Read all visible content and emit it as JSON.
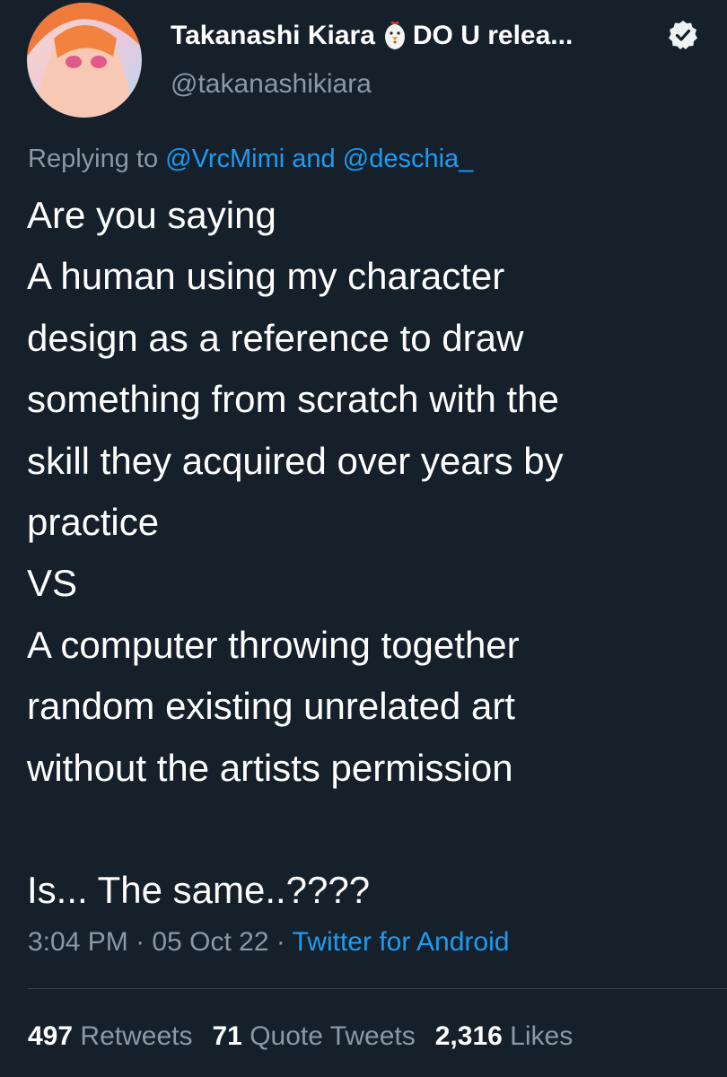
{
  "author": {
    "display_name": "Takanashi Kiara",
    "name_emoji": "chicken-emoji",
    "name_suffix": "DO U relea...",
    "handle": "@takanashikiara",
    "verified_icon": "verified-badge-icon"
  },
  "reply": {
    "prefix": "Replying to",
    "user1": "@VrcMimi",
    "conjunction": "and",
    "user2": "@deschia_"
  },
  "tweet": {
    "lines": [
      "Are you saying",
      "A human using my character",
      "design as a reference to draw",
      "something from scratch with the",
      "skill they acquired over years by",
      "practice",
      "VS",
      "A computer throwing together",
      "random existing unrelated art",
      "without the artists permission",
      "",
      "Is... The same..????"
    ]
  },
  "meta": {
    "time": "3:04 PM",
    "date": "05 Oct 22",
    "separator": "·",
    "source": "Twitter for Android"
  },
  "stats": {
    "retweets_count": "497",
    "retweets_label": "Retweets",
    "quotes_count": "71",
    "quotes_label": "Quote Tweets",
    "likes_count": "2,316",
    "likes_label": "Likes"
  },
  "colors": {
    "background": "#15202b",
    "text_primary": "#ffffff",
    "text_secondary": "#8b98a5",
    "link": "#1d9bf0",
    "divider": "#38444d"
  }
}
